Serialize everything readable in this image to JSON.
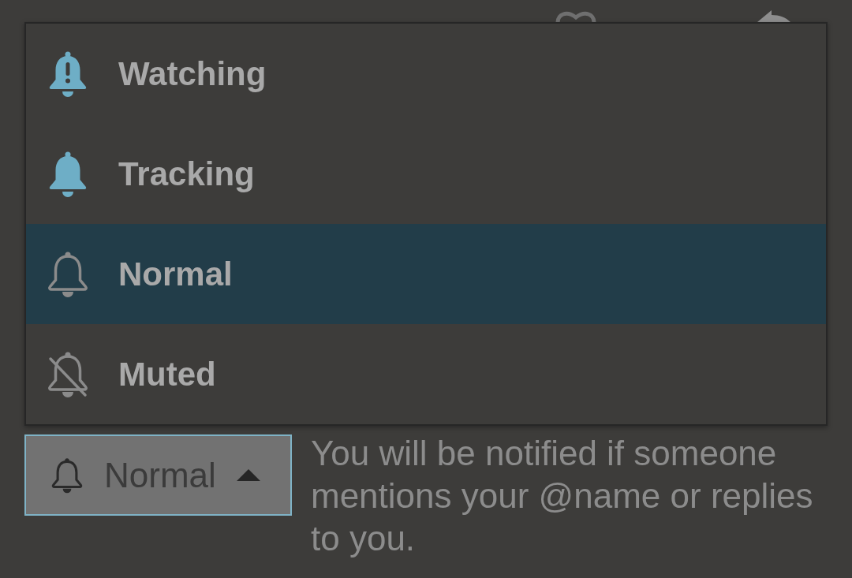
{
  "notification_menu": {
    "items": [
      {
        "kind": "watching",
        "label": "Watching",
        "selected": false
      },
      {
        "kind": "tracking",
        "label": "Tracking",
        "selected": false
      },
      {
        "kind": "normal",
        "label": "Normal",
        "selected": true
      },
      {
        "kind": "muted",
        "label": "Muted",
        "selected": false
      }
    ]
  },
  "notification_button": {
    "kind": "normal",
    "label": "Normal",
    "expanded": true
  },
  "description": "You will be notified if someone mentions your @name or replies to you."
}
